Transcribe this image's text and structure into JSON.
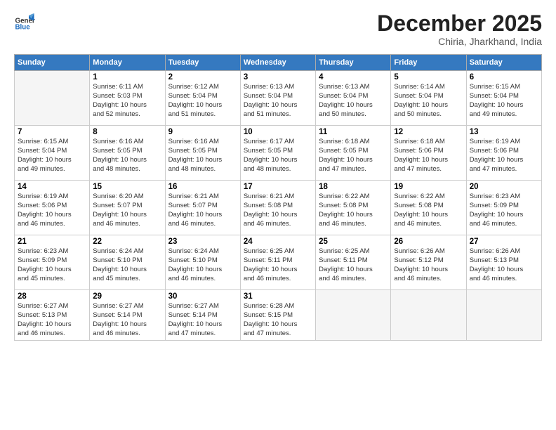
{
  "logo": {
    "general": "General",
    "blue": "Blue"
  },
  "title": "December 2025",
  "subtitle": "Chiria, Jharkhand, India",
  "days_header": [
    "Sunday",
    "Monday",
    "Tuesday",
    "Wednesday",
    "Thursday",
    "Friday",
    "Saturday"
  ],
  "weeks": [
    [
      {
        "num": "",
        "info": ""
      },
      {
        "num": "1",
        "info": "Sunrise: 6:11 AM\nSunset: 5:03 PM\nDaylight: 10 hours\nand 52 minutes."
      },
      {
        "num": "2",
        "info": "Sunrise: 6:12 AM\nSunset: 5:04 PM\nDaylight: 10 hours\nand 51 minutes."
      },
      {
        "num": "3",
        "info": "Sunrise: 6:13 AM\nSunset: 5:04 PM\nDaylight: 10 hours\nand 51 minutes."
      },
      {
        "num": "4",
        "info": "Sunrise: 6:13 AM\nSunset: 5:04 PM\nDaylight: 10 hours\nand 50 minutes."
      },
      {
        "num": "5",
        "info": "Sunrise: 6:14 AM\nSunset: 5:04 PM\nDaylight: 10 hours\nand 50 minutes."
      },
      {
        "num": "6",
        "info": "Sunrise: 6:15 AM\nSunset: 5:04 PM\nDaylight: 10 hours\nand 49 minutes."
      }
    ],
    [
      {
        "num": "7",
        "info": "Sunrise: 6:15 AM\nSunset: 5:04 PM\nDaylight: 10 hours\nand 49 minutes."
      },
      {
        "num": "8",
        "info": "Sunrise: 6:16 AM\nSunset: 5:05 PM\nDaylight: 10 hours\nand 48 minutes."
      },
      {
        "num": "9",
        "info": "Sunrise: 6:16 AM\nSunset: 5:05 PM\nDaylight: 10 hours\nand 48 minutes."
      },
      {
        "num": "10",
        "info": "Sunrise: 6:17 AM\nSunset: 5:05 PM\nDaylight: 10 hours\nand 48 minutes."
      },
      {
        "num": "11",
        "info": "Sunrise: 6:18 AM\nSunset: 5:05 PM\nDaylight: 10 hours\nand 47 minutes."
      },
      {
        "num": "12",
        "info": "Sunrise: 6:18 AM\nSunset: 5:06 PM\nDaylight: 10 hours\nand 47 minutes."
      },
      {
        "num": "13",
        "info": "Sunrise: 6:19 AM\nSunset: 5:06 PM\nDaylight: 10 hours\nand 47 minutes."
      }
    ],
    [
      {
        "num": "14",
        "info": "Sunrise: 6:19 AM\nSunset: 5:06 PM\nDaylight: 10 hours\nand 46 minutes."
      },
      {
        "num": "15",
        "info": "Sunrise: 6:20 AM\nSunset: 5:07 PM\nDaylight: 10 hours\nand 46 minutes."
      },
      {
        "num": "16",
        "info": "Sunrise: 6:21 AM\nSunset: 5:07 PM\nDaylight: 10 hours\nand 46 minutes."
      },
      {
        "num": "17",
        "info": "Sunrise: 6:21 AM\nSunset: 5:08 PM\nDaylight: 10 hours\nand 46 minutes."
      },
      {
        "num": "18",
        "info": "Sunrise: 6:22 AM\nSunset: 5:08 PM\nDaylight: 10 hours\nand 46 minutes."
      },
      {
        "num": "19",
        "info": "Sunrise: 6:22 AM\nSunset: 5:08 PM\nDaylight: 10 hours\nand 46 minutes."
      },
      {
        "num": "20",
        "info": "Sunrise: 6:23 AM\nSunset: 5:09 PM\nDaylight: 10 hours\nand 46 minutes."
      }
    ],
    [
      {
        "num": "21",
        "info": "Sunrise: 6:23 AM\nSunset: 5:09 PM\nDaylight: 10 hours\nand 45 minutes."
      },
      {
        "num": "22",
        "info": "Sunrise: 6:24 AM\nSunset: 5:10 PM\nDaylight: 10 hours\nand 45 minutes."
      },
      {
        "num": "23",
        "info": "Sunrise: 6:24 AM\nSunset: 5:10 PM\nDaylight: 10 hours\nand 46 minutes."
      },
      {
        "num": "24",
        "info": "Sunrise: 6:25 AM\nSunset: 5:11 PM\nDaylight: 10 hours\nand 46 minutes."
      },
      {
        "num": "25",
        "info": "Sunrise: 6:25 AM\nSunset: 5:11 PM\nDaylight: 10 hours\nand 46 minutes."
      },
      {
        "num": "26",
        "info": "Sunrise: 6:26 AM\nSunset: 5:12 PM\nDaylight: 10 hours\nand 46 minutes."
      },
      {
        "num": "27",
        "info": "Sunrise: 6:26 AM\nSunset: 5:13 PM\nDaylight: 10 hours\nand 46 minutes."
      }
    ],
    [
      {
        "num": "28",
        "info": "Sunrise: 6:27 AM\nSunset: 5:13 PM\nDaylight: 10 hours\nand 46 minutes."
      },
      {
        "num": "29",
        "info": "Sunrise: 6:27 AM\nSunset: 5:14 PM\nDaylight: 10 hours\nand 46 minutes."
      },
      {
        "num": "30",
        "info": "Sunrise: 6:27 AM\nSunset: 5:14 PM\nDaylight: 10 hours\nand 47 minutes."
      },
      {
        "num": "31",
        "info": "Sunrise: 6:28 AM\nSunset: 5:15 PM\nDaylight: 10 hours\nand 47 minutes."
      },
      {
        "num": "",
        "info": ""
      },
      {
        "num": "",
        "info": ""
      },
      {
        "num": "",
        "info": ""
      }
    ]
  ]
}
